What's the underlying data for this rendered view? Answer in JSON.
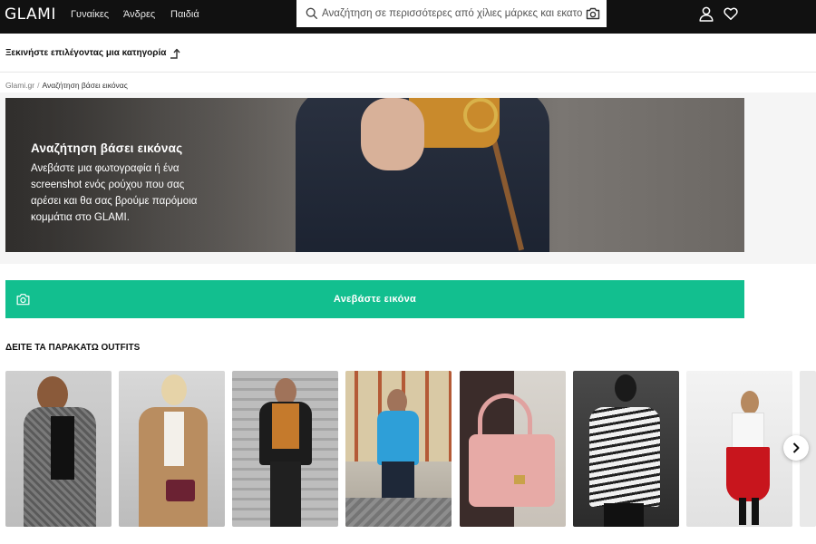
{
  "header": {
    "logo": "GLAMI",
    "nav": [
      "Γυναίκες",
      "Άνδρες",
      "Παιδιά"
    ],
    "search_placeholder": "Αναζήτηση σε περισσότερες από χίλιες μάρκες και εκατομμύρια προϊόντα",
    "icons": [
      "search-icon",
      "camera-icon",
      "user-icon",
      "heart-icon"
    ]
  },
  "category_bar": {
    "label": "Ξεκινήστε επιλέγοντας μια κατηγορία"
  },
  "breadcrumb": {
    "home": "Glami.gr",
    "current": "Αναζήτηση βάσει εικόνας"
  },
  "hero": {
    "title": "Αναζήτηση βάσει εικόνας",
    "text": "Ανεβάστε μια φωτογραφία ή ένα screenshot ενός ρούχου που σας αρέσει και θα σας βρούμε παρόμοια κομμάτια στο GLAMI."
  },
  "upload": {
    "label": "Ανεβάστε εικόνα"
  },
  "outfits": {
    "title": "ΔΕΙΤΕ ΤΑ ΠΑΡΑΚΑΤΩ OUTFITS",
    "count": 7
  },
  "colors": {
    "topbar": "#111111",
    "accent": "#12bf8f"
  }
}
